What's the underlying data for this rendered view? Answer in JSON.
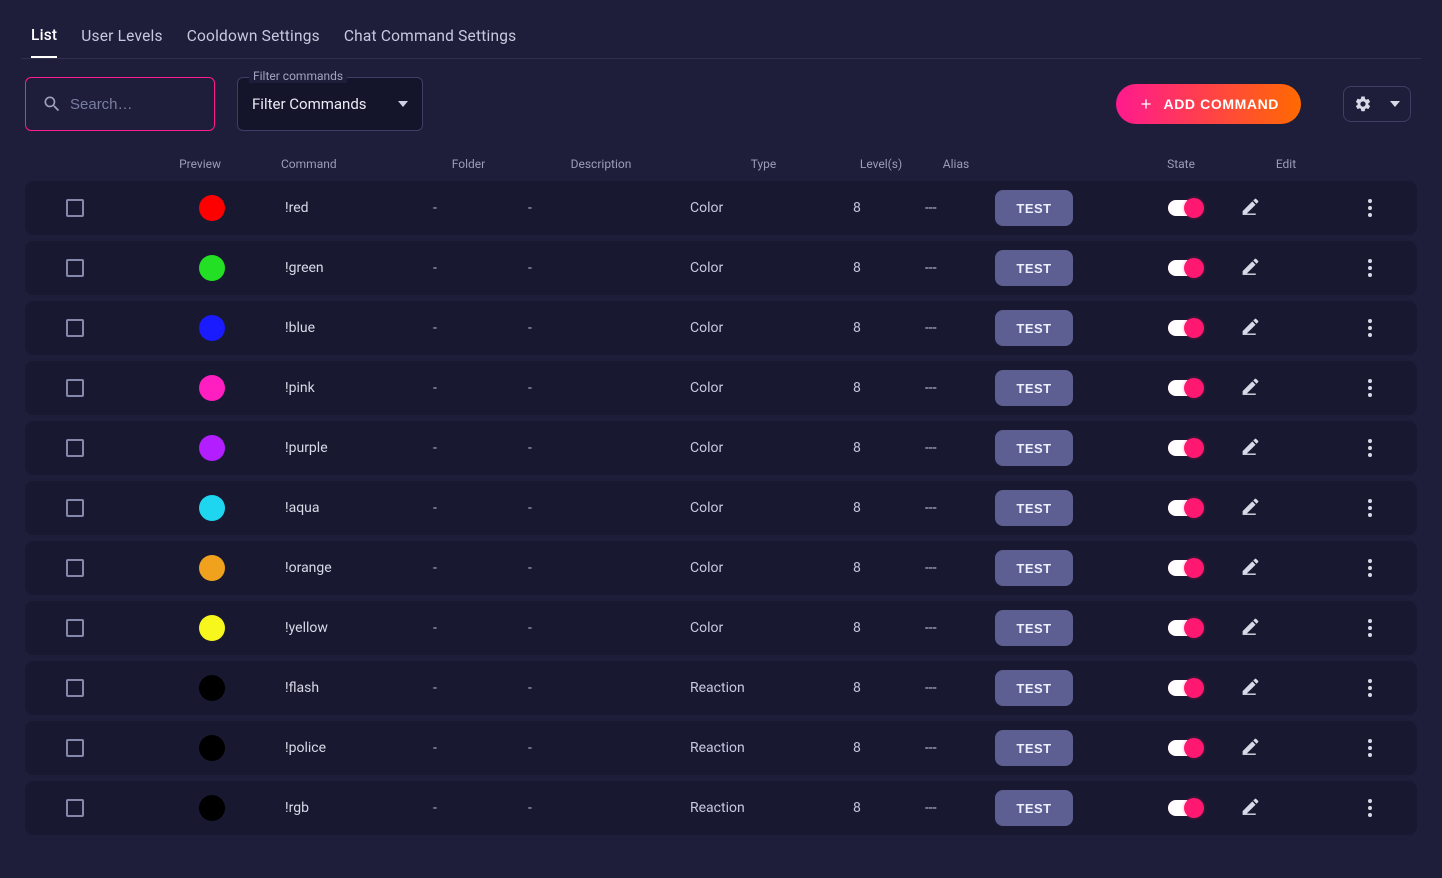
{
  "tabs": [
    "List",
    "User Levels",
    "Cooldown Settings",
    "Chat Command Settings"
  ],
  "active_tab_index": 0,
  "search": {
    "placeholder": "Search…",
    "value": ""
  },
  "filter": {
    "legend": "Filter commands",
    "selected": "Filter Commands"
  },
  "add_button_label": "ADD COMMAND",
  "headers": {
    "preview": "Preview",
    "command": "Command",
    "folder": "Folder",
    "description": "Description",
    "type": "Type",
    "levels": "Level(s)",
    "alias": "Alias",
    "state": "State",
    "edit": "Edit"
  },
  "test_button_label": "TEST",
  "rows": [
    {
      "color": "#ff0000",
      "command": "!red",
      "folder": "-",
      "description": "-",
      "type": "Color",
      "levels": "8",
      "alias": "---",
      "state": true
    },
    {
      "color": "#24e024",
      "command": "!green",
      "folder": "-",
      "description": "-",
      "type": "Color",
      "levels": "8",
      "alias": "---",
      "state": true
    },
    {
      "color": "#1b1bff",
      "command": "!blue",
      "folder": "-",
      "description": "-",
      "type": "Color",
      "levels": "8",
      "alias": "---",
      "state": true
    },
    {
      "color": "#ff1ec0",
      "command": "!pink",
      "folder": "-",
      "description": "-",
      "type": "Color",
      "levels": "8",
      "alias": "---",
      "state": true
    },
    {
      "color": "#b21eff",
      "command": "!purple",
      "folder": "-",
      "description": "-",
      "type": "Color",
      "levels": "8",
      "alias": "---",
      "state": true
    },
    {
      "color": "#1ed6f0",
      "command": "!aqua",
      "folder": "-",
      "description": "-",
      "type": "Color",
      "levels": "8",
      "alias": "---",
      "state": true
    },
    {
      "color": "#f0a21e",
      "command": "!orange",
      "folder": "-",
      "description": "-",
      "type": "Color",
      "levels": "8",
      "alias": "---",
      "state": true
    },
    {
      "color": "#f7f71e",
      "command": "!yellow",
      "folder": "-",
      "description": "-",
      "type": "Color",
      "levels": "8",
      "alias": "---",
      "state": true
    },
    {
      "color": "#000000",
      "command": "!flash",
      "folder": "-",
      "description": "-",
      "type": "Reaction",
      "levels": "8",
      "alias": "---",
      "state": true
    },
    {
      "color": "#000000",
      "command": "!police",
      "folder": "-",
      "description": "-",
      "type": "Reaction",
      "levels": "8",
      "alias": "---",
      "state": true
    },
    {
      "color": "#000000",
      "command": "!rgb",
      "folder": "-",
      "description": "-",
      "type": "Reaction",
      "levels": "8",
      "alias": "---",
      "state": true
    }
  ]
}
